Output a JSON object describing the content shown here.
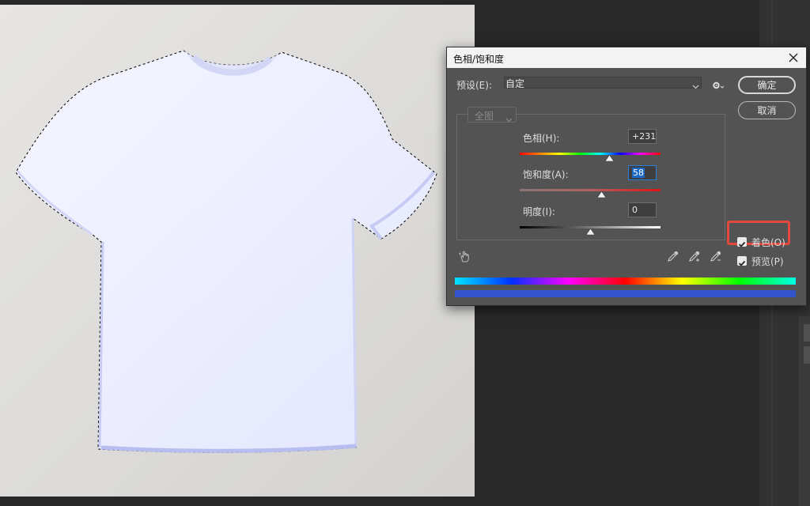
{
  "dialog": {
    "title": "色相/饱和度",
    "preset_label": "预设(E):",
    "preset_value": "自定",
    "ok_label": "确定",
    "cancel_label": "取消",
    "channel_value": "全图",
    "hue_label": "色相(H):",
    "hue_value": "+231",
    "saturation_label": "饱和度(A):",
    "saturation_value": "58",
    "lightness_label": "明度(I):",
    "lightness_value": "0",
    "colorize_label": "着色(O)",
    "preview_label": "预览(P)",
    "colorize_checked": true,
    "preview_checked": true
  },
  "colors": {
    "highlight_frame": "#e2483c",
    "colorized_bar": "#3355cc",
    "shirt_tint": "#eef0ff"
  },
  "icons": [
    "close-icon",
    "chevron-down-icon",
    "gear-icon",
    "hand-adjust-icon",
    "eyedropper-icon",
    "eyedropper-plus-icon",
    "eyedropper-minus-icon",
    "check-icon"
  ]
}
